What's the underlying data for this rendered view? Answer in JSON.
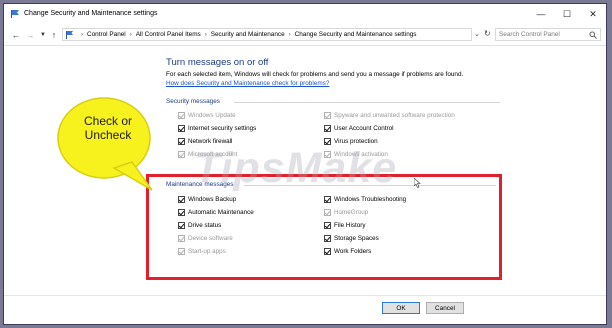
{
  "window": {
    "title": "Change Security and Maintenance settings"
  },
  "address": {
    "crumbs": [
      "Control Panel",
      "All Control Panel Items",
      "Security and Maintenance",
      "Change Security and Maintenance settings"
    ],
    "search_placeholder": "Search Control Panel"
  },
  "main": {
    "heading": "Turn messages on or off",
    "description": "For each selected item, Windows will check for problems and send you a message if problems are found.",
    "link": "How does Security and Maintenance check for problems?"
  },
  "security": {
    "label": "Security messages",
    "items": [
      {
        "label": "Windows Update",
        "checked": true,
        "enabled": false
      },
      {
        "label": "Spyware and unwanted software protection",
        "checked": true,
        "enabled": false
      },
      {
        "label": "Internet security settings",
        "checked": true,
        "enabled": true
      },
      {
        "label": "User Account Control",
        "checked": true,
        "enabled": true
      },
      {
        "label": "Network firewall",
        "checked": true,
        "enabled": true
      },
      {
        "label": "Virus protection",
        "checked": true,
        "enabled": true
      },
      {
        "label": "Microsoft account",
        "checked": true,
        "enabled": false
      },
      {
        "label": "Windows activation",
        "checked": true,
        "enabled": false
      }
    ]
  },
  "maintenance": {
    "label": "Maintenance messages",
    "items": [
      {
        "label": "Windows Backup",
        "checked": true,
        "enabled": true
      },
      {
        "label": "Windows Troubleshooting",
        "checked": true,
        "enabled": true
      },
      {
        "label": "Automatic Maintenance",
        "checked": true,
        "enabled": true
      },
      {
        "label": "HomeGroup",
        "checked": true,
        "enabled": false
      },
      {
        "label": "Drive status",
        "checked": true,
        "enabled": true
      },
      {
        "label": "File History",
        "checked": true,
        "enabled": true
      },
      {
        "label": "Device software",
        "checked": true,
        "enabled": false
      },
      {
        "label": "Storage Spaces",
        "checked": true,
        "enabled": true
      },
      {
        "label": "Start-up apps",
        "checked": true,
        "enabled": false
      },
      {
        "label": "Work Folders",
        "checked": true,
        "enabled": true
      }
    ]
  },
  "buttons": {
    "ok": "OK",
    "cancel": "Cancel"
  },
  "callout": {
    "line1": "Check or",
    "line2": "Uncheck"
  },
  "watermark": "TipsMake",
  "colors": {
    "highlight_box": "#e0202a",
    "callout_fill": "#f7f21e",
    "heading": "#1e3a8a",
    "link": "#1a56c7"
  }
}
